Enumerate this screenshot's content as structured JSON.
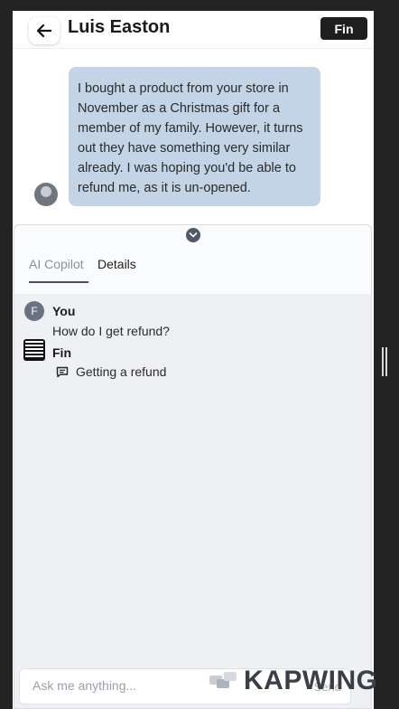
{
  "header": {
    "title": "Luis Easton",
    "fin_button_label": "Fin"
  },
  "conversation": {
    "customer_message": "I bought a product from your store in November as a Christmas gift for a member of my family. However, it turns out they have something very similar already. I was hoping you'd be able to refund me, as it is un-opened."
  },
  "panel": {
    "tabs": [
      {
        "label": "AI Copilot",
        "active": true
      },
      {
        "label": "Details",
        "active": false
      }
    ],
    "messages": [
      {
        "avatar": "F",
        "author": "You",
        "text": "How do I get refund?"
      },
      {
        "author": "Fin",
        "source_label": "Getting a refund"
      }
    ]
  },
  "composer": {
    "placeholder": "Ask me anything...",
    "send_label": "Send"
  },
  "watermark": {
    "text": "KAPWING"
  },
  "colors": {
    "bubble": "#c3d4e7",
    "fin_button": "#1e1e1e",
    "panel_bg": "#eef0f4"
  }
}
